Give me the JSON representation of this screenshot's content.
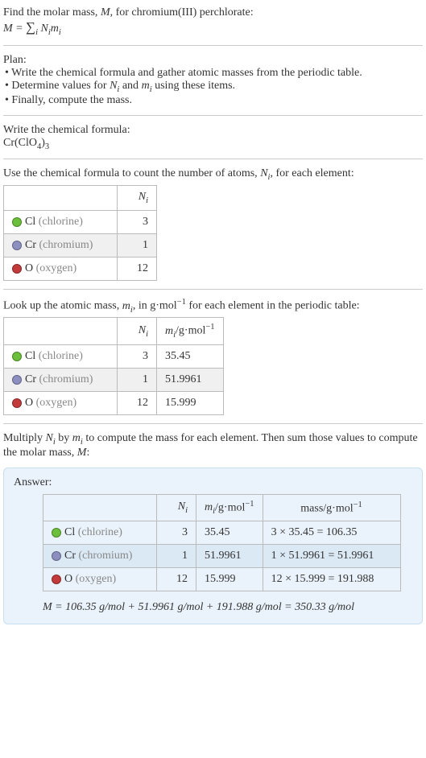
{
  "header": {
    "title_line": "Find the molar mass, M, for chromium(III) perchlorate:",
    "formula_text": "M = ∑ Nᵢmᵢ",
    "sum_index": "i"
  },
  "plan": {
    "heading": "Plan:",
    "items": [
      "• Write the chemical formula and gather atomic masses from the periodic table.",
      "• Determine values for Nᵢ and mᵢ using these items.",
      "• Finally, compute the mass."
    ]
  },
  "chemical_formula": {
    "heading": "Write the chemical formula:",
    "value": "Cr(ClO₄)₃"
  },
  "count_atoms": {
    "heading": "Use the chemical formula to count the number of atoms, Nᵢ, for each element:",
    "headers": {
      "ni": "Nᵢ"
    },
    "rows": [
      {
        "dot": "dot-cl",
        "sym": "Cl",
        "name": "(chlorine)",
        "ni": "3"
      },
      {
        "dot": "dot-cr",
        "sym": "Cr",
        "name": "(chromium)",
        "ni": "1"
      },
      {
        "dot": "dot-o",
        "sym": "O",
        "name": "(oxygen)",
        "ni": "12"
      }
    ]
  },
  "atomic_mass": {
    "heading": "Look up the atomic mass, mᵢ, in g·mol⁻¹ for each element in the periodic table:",
    "headers": {
      "ni": "Nᵢ",
      "mi": "mᵢ/g·mol⁻¹"
    },
    "rows": [
      {
        "dot": "dot-cl",
        "sym": "Cl",
        "name": "(chlorine)",
        "ni": "3",
        "mi": "35.45"
      },
      {
        "dot": "dot-cr",
        "sym": "Cr",
        "name": "(chromium)",
        "ni": "1",
        "mi": "51.9961"
      },
      {
        "dot": "dot-o",
        "sym": "O",
        "name": "(oxygen)",
        "ni": "12",
        "mi": "15.999"
      }
    ]
  },
  "multiply": {
    "heading": "Multiply Nᵢ by mᵢ to compute the mass for each element. Then sum those values to compute the molar mass, M:"
  },
  "answer": {
    "label": "Answer:",
    "headers": {
      "ni": "Nᵢ",
      "mi": "mᵢ/g·mol⁻¹",
      "mass": "mass/g·mol⁻¹"
    },
    "rows": [
      {
        "dot": "dot-cl",
        "sym": "Cl",
        "name": "(chlorine)",
        "ni": "3",
        "mi": "35.45",
        "mass": "3 × 35.45 = 106.35"
      },
      {
        "dot": "dot-cr",
        "sym": "Cr",
        "name": "(chromium)",
        "ni": "1",
        "mi": "51.9961",
        "mass": "1 × 51.9961 = 51.9961"
      },
      {
        "dot": "dot-o",
        "sym": "O",
        "name": "(oxygen)",
        "ni": "12",
        "mi": "15.999",
        "mass": "12 × 15.999 = 191.988"
      }
    ],
    "final": "M = 106.35 g/mol + 51.9961 g/mol + 191.988 g/mol = 350.33 g/mol"
  }
}
